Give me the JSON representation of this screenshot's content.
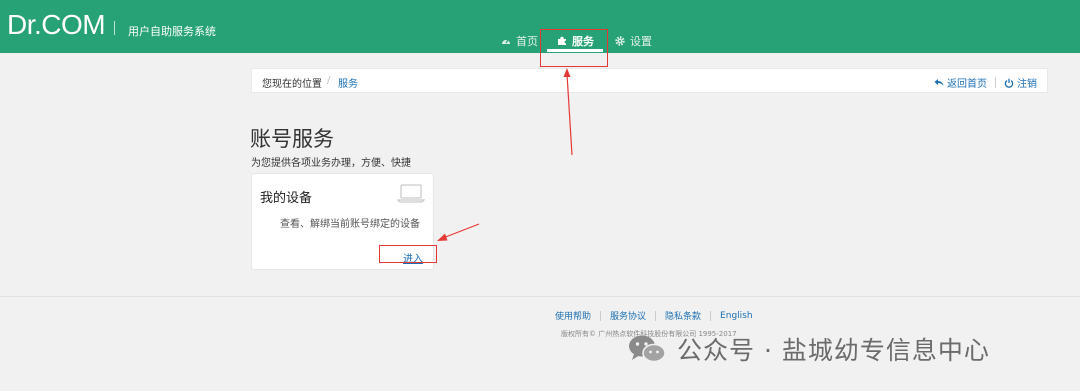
{
  "header": {
    "logo": "Dr.COM",
    "system_name": "用户自助服务系统",
    "nav": [
      {
        "label": "首页",
        "icon": "dashboard-icon"
      },
      {
        "label": "服务",
        "icon": "puzzle-icon"
      },
      {
        "label": "设置",
        "icon": "gear-icon"
      }
    ]
  },
  "breadcrumb": {
    "here": "您现在的位置",
    "separator": "/",
    "current": "服务",
    "back_home": "返回首页",
    "logout": "注销"
  },
  "page": {
    "title": "账号服务",
    "subtitle": "为您提供各项业务办理，方便、快捷"
  },
  "card": {
    "title": "我的设备",
    "icon": "laptop-icon",
    "description": "查看、解绑当前账号绑定的设备",
    "enter": "进入"
  },
  "footer": {
    "links": [
      "使用帮助",
      "服务协议",
      "隐私条款",
      "English"
    ],
    "copyright": "版权所有© 广州热点软件科技股份有限公司 1995-2017"
  },
  "watermark": {
    "text": "公众号 · 盐城幼专信息中心"
  },
  "colors": {
    "header_bg": "#26a276",
    "link": "#1c6fb4",
    "annotation": "#e53935"
  }
}
